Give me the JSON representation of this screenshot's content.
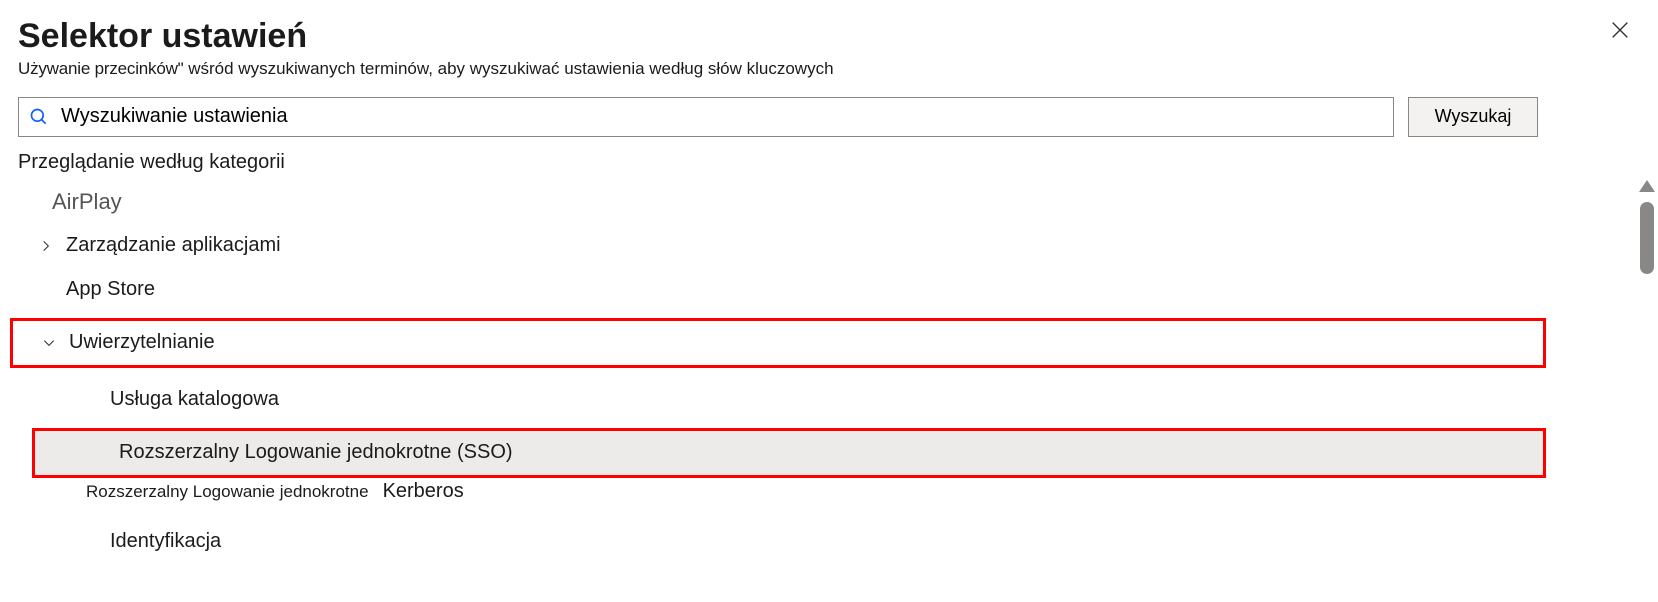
{
  "title": "Selektor ustawień",
  "subtitle_prefix": "Używanie przecinków\"",
  "subtitle_rest": " wśród wyszukiwanych terminów, aby wyszukiwać ustawienia według słów kluczowych",
  "search": {
    "value": "Wyszukiwanie ustawienia",
    "button": "Wyszukaj"
  },
  "browse_label": "Przeglądanie według kategorii",
  "tree": {
    "airplay": "AirPlay",
    "app_management": "Zarządzanie aplikacjami",
    "app_store": "App Store",
    "authentication": "Uwierzytelnianie",
    "directory_service": "Usługa katalogowa",
    "extensible_sso": "Rozszerzalny Logowanie jednokrotne (SSO)",
    "extensible_sso_short": "Rozszerzalny Logowanie jednokrotne",
    "kerberos": "Kerberos",
    "identification": "Identyfikacja"
  }
}
